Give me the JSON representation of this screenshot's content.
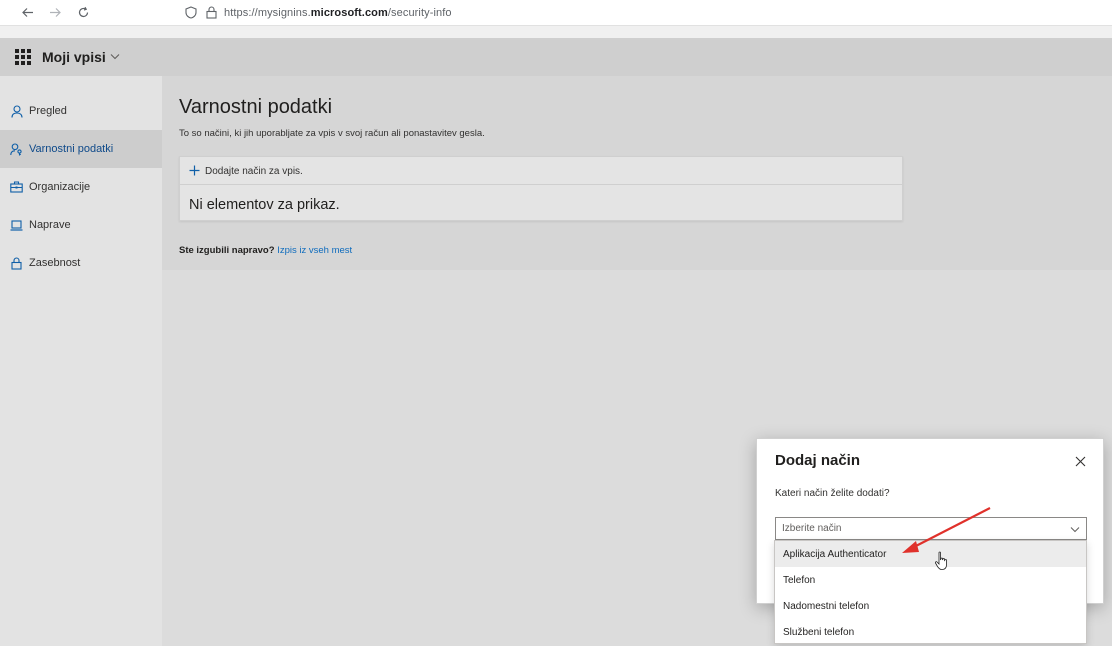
{
  "browser": {
    "url_prefix": "https://mysignins.",
    "url_domain": "microsoft.com",
    "url_path": "/security-info"
  },
  "app": {
    "title": "Moji vpisi"
  },
  "sidebar": {
    "items": [
      {
        "label": "Pregled",
        "icon": "person-icon"
      },
      {
        "label": "Varnostni podatki",
        "icon": "person-key-icon",
        "active": true
      },
      {
        "label": "Organizacije",
        "icon": "briefcase-icon"
      },
      {
        "label": "Naprave",
        "icon": "laptop-icon"
      },
      {
        "label": "Zasebnost",
        "icon": "lock-icon"
      }
    ]
  },
  "main": {
    "title": "Varnostni podatki",
    "subtitle": "To so načini, ki jih uporabljate za vpis v svoj račun ali ponastavitev gesla.",
    "add_method_label": "Dodajte način za vpis.",
    "empty_text": "Ni elementov za prikaz.",
    "lost_device_question": "Ste izgubili napravo?",
    "lost_device_link": "Izpis iz vseh mest"
  },
  "dialog": {
    "title": "Dodaj način",
    "question": "Kateri način želite dodati?",
    "select_placeholder": "Izberite način",
    "options": [
      "Aplikacija Authenticator",
      "Telefon",
      "Nadomestni telefon",
      "Službeni telefon"
    ]
  },
  "colors": {
    "accent": "#0f6cbd",
    "annotation_arrow": "#e0312b"
  }
}
